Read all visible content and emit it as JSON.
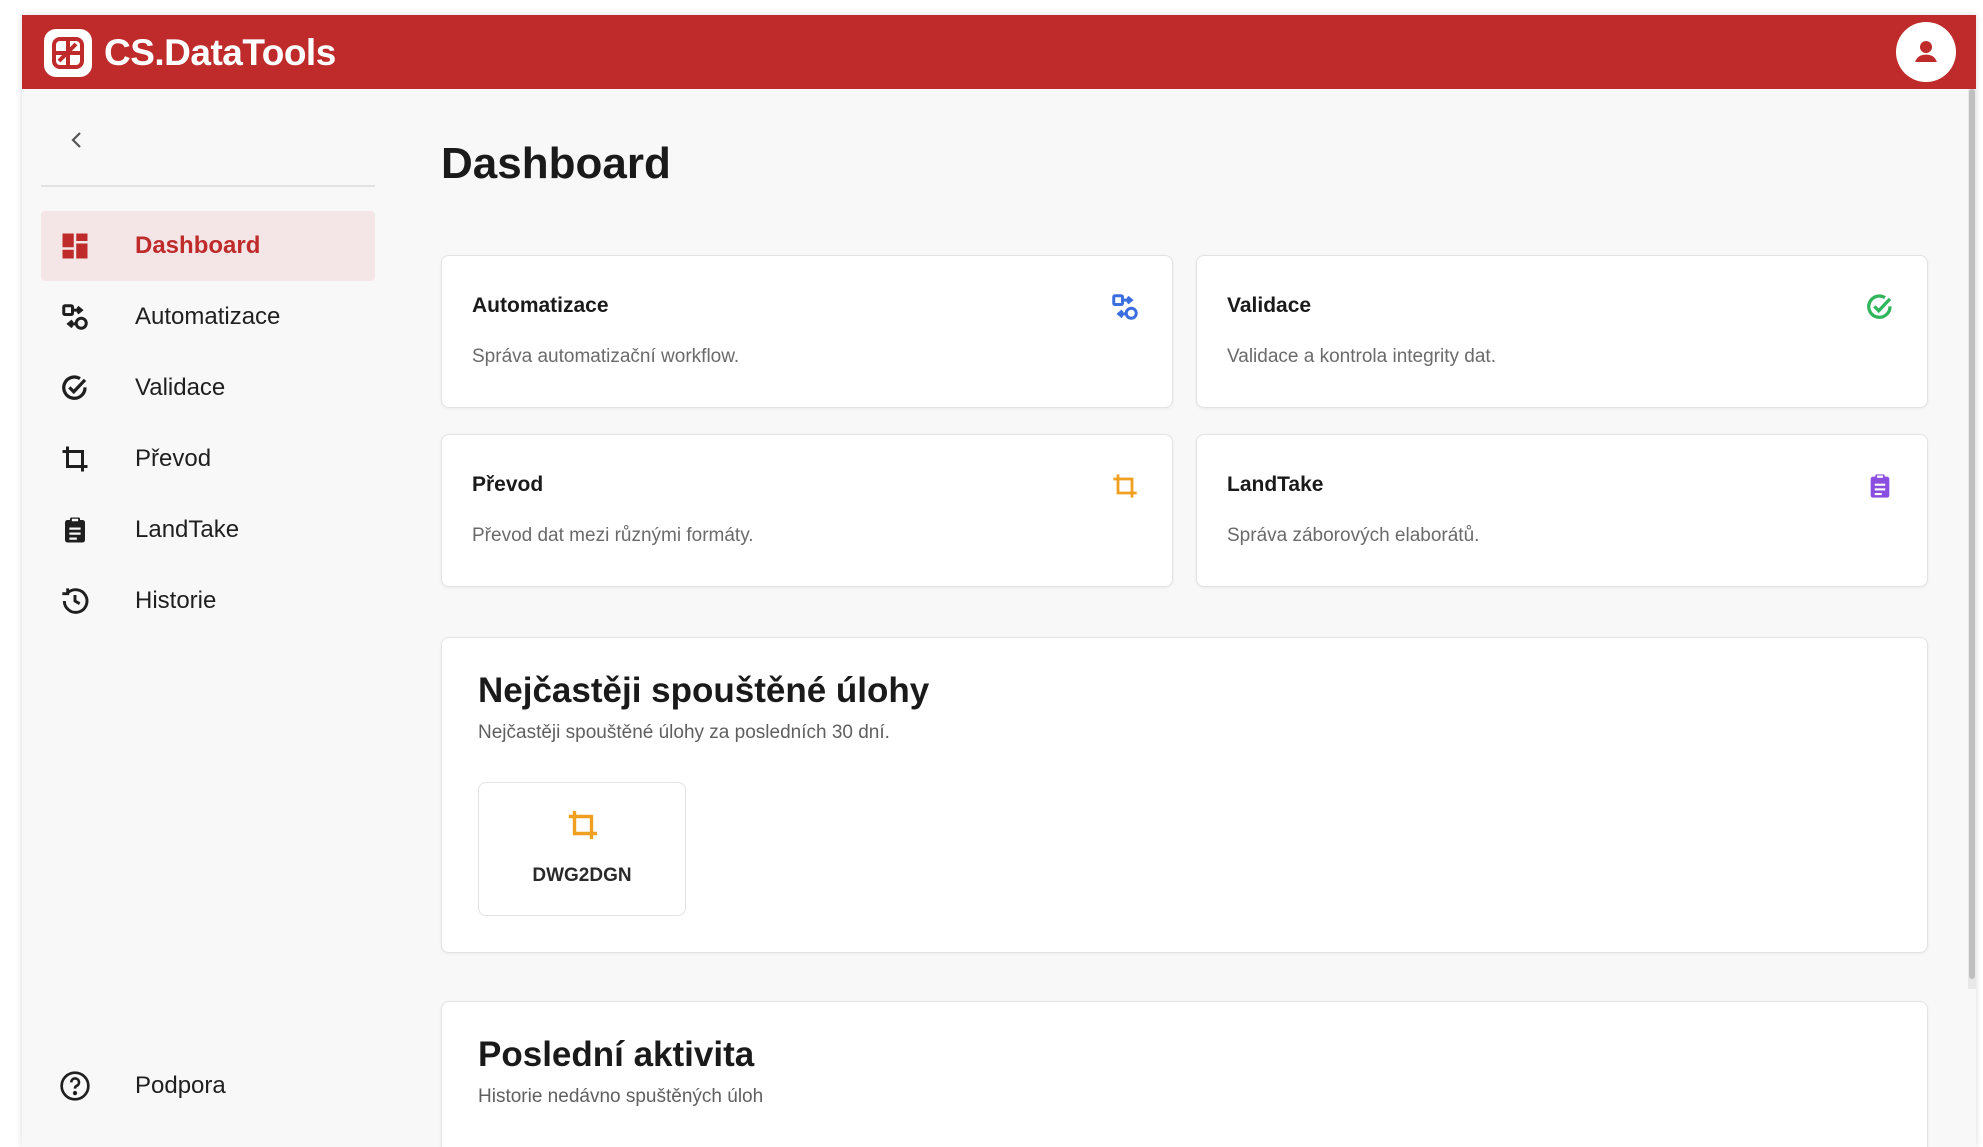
{
  "app": {
    "brand": "CS.DataTools",
    "brand_color": "#bf2b2b"
  },
  "sidebar": {
    "items": [
      {
        "label": "Dashboard",
        "icon": "dashboard-icon",
        "active": true
      },
      {
        "label": "Automatizace",
        "icon": "automation-icon"
      },
      {
        "label": "Validace",
        "icon": "validate-check-icon"
      },
      {
        "label": "Převod",
        "icon": "crop-convert-icon"
      },
      {
        "label": "LandTake",
        "icon": "clipboard-icon"
      },
      {
        "label": "Historie",
        "icon": "history-icon"
      }
    ],
    "support": {
      "label": "Podpora",
      "icon": "help-circle-icon"
    }
  },
  "main": {
    "title": "Dashboard",
    "cards": [
      {
        "title": "Automatizace",
        "description": "Správa automatizační workflow.",
        "icon": "automation-icon",
        "icon_color": "#3b6fe0"
      },
      {
        "title": "Validace",
        "description": "Validace a kontrola integrity dat.",
        "icon": "validate-check-icon",
        "icon_color": "#2fb55a"
      },
      {
        "title": "Převod",
        "description": "Převod dat mezi různými formáty.",
        "icon": "crop-convert-icon",
        "icon_color": "#f0a020"
      },
      {
        "title": "LandTake",
        "description": "Správa záborových elaborátů.",
        "icon": "clipboard-icon",
        "icon_color": "#8a4fe0"
      }
    ],
    "frequent": {
      "title": "Nejčastěji spouštěné úlohy",
      "subtitle": "Nejčastěji spouštěné úlohy za posledních 30 dní.",
      "tasks": [
        {
          "label": "DWG2DGN",
          "icon": "crop-convert-icon",
          "icon_color": "#f0a020"
        }
      ]
    },
    "recent": {
      "title": "Poslední aktivita",
      "subtitle": "Historie nedávno spuštěných úloh"
    }
  }
}
